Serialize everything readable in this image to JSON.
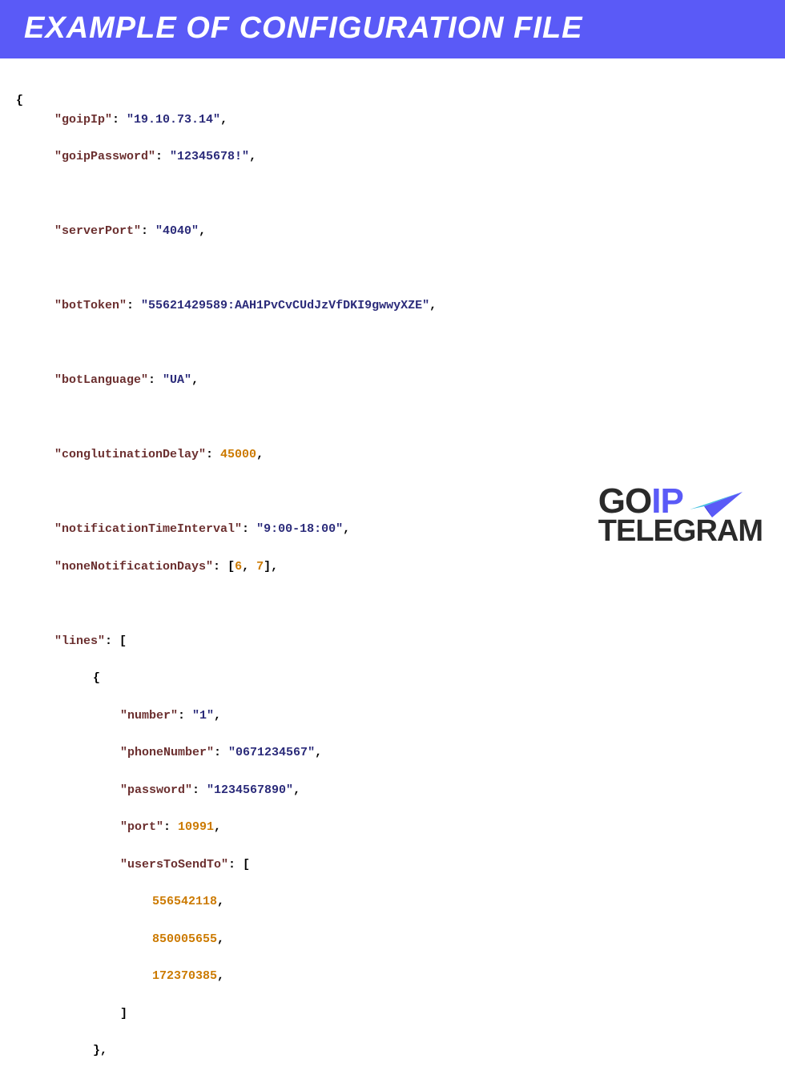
{
  "header": {
    "title": "EXAMPLE OF CONFIGURATION FILE"
  },
  "config": {
    "goipIp_key": "\"goipIp\"",
    "goipIp_val": "\"19.10.73.14\"",
    "goipPassword_key": "\"goipPassword\"",
    "goipPassword_val": "\"12345678!\"",
    "serverPort_key": "\"serverPort\"",
    "serverPort_val": "\"4040\"",
    "botToken_key": "\"botToken\"",
    "botToken_val": "\"55621429589:AAH1PvCvCUdJzVfDKI9gwwyXZE\"",
    "botLanguage_key": "\"botLanguage\"",
    "botLanguage_val": "\"UA\"",
    "conglutinationDelay_key": "\"conglutinationDelay\"",
    "conglutinationDelay_val": "45000",
    "notificationTimeInterval_key": "\"notificationTimeInterval\"",
    "notificationTimeInterval_val": "\"9:00-18:00\"",
    "noneNotificationDays_key": "\"noneNotificationDays\"",
    "noneNotificationDays_open": "[",
    "noneNotificationDays_v1": "6",
    "noneNotificationDays_v2": "7",
    "noneNotificationDays_close": "]",
    "lines_key": "\"lines\"",
    "line0": {
      "number_key": "\"number\"",
      "number_val": "\"1\"",
      "phoneNumber_key": "\"phoneNumber\"",
      "phoneNumber_val": "\"0671234567\"",
      "password_key": "\"password\"",
      "password_val": "\"1234567890\"",
      "port_key": "\"port\"",
      "port_val": "10991",
      "usersToSendTo_key": "\"usersToSendTo\"",
      "user0": "556542118",
      "user1": "850005655",
      "user2": "172370385"
    }
  },
  "logo": {
    "go": "GO",
    "ip": "IP",
    "telegram": "TELEGRAM"
  }
}
